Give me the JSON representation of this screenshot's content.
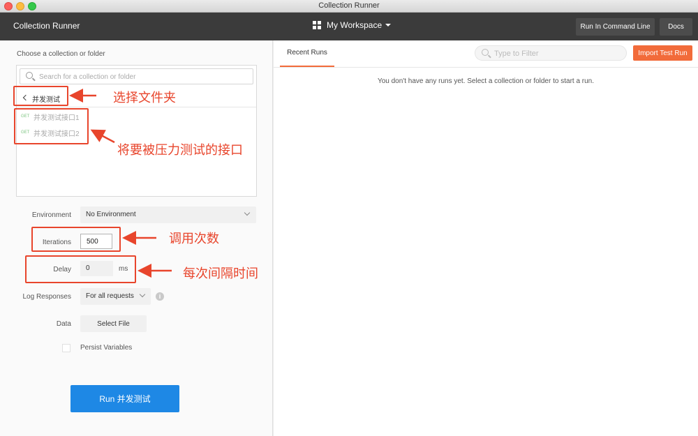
{
  "window": {
    "title": "Collection Runner"
  },
  "header": {
    "app_title": "Collection Runner",
    "workspace": "My Workspace",
    "run_cli_label": "Run In Command Line",
    "docs_label": "Docs"
  },
  "left": {
    "choose_label": "Choose a collection or folder",
    "search_placeholder": "Search for a collection or folder",
    "folder_name": "并发测试",
    "requests": [
      {
        "method": "GET",
        "name": "并发测试接口1"
      },
      {
        "method": "GET",
        "name": "并发测试接口2"
      }
    ],
    "environment": {
      "label": "Environment",
      "value": "No Environment"
    },
    "iterations": {
      "label": "Iterations",
      "value": "500"
    },
    "delay": {
      "label": "Delay",
      "value": "0",
      "unit": "ms"
    },
    "log_responses": {
      "label": "Log Responses",
      "value": "For all requests"
    },
    "data": {
      "label": "Data",
      "button": "Select File"
    },
    "persist_label": "Persist Variables",
    "run_button": "Run 并发测试"
  },
  "right": {
    "tab_recent": "Recent Runs",
    "filter_placeholder": "Type to Filter",
    "import_button": "Import Test Run",
    "empty_message": "You don't have any runs yet. Select a collection or folder to start a run."
  },
  "annotations": {
    "folder": "选择文件夹",
    "requests": "将要被压力测试的接口",
    "iterations": "调用次数",
    "delay": "每次间隔时间"
  },
  "colors": {
    "accent": "#f26b3a",
    "run_button": "#1e88e5",
    "annotation": "#e8452c"
  }
}
